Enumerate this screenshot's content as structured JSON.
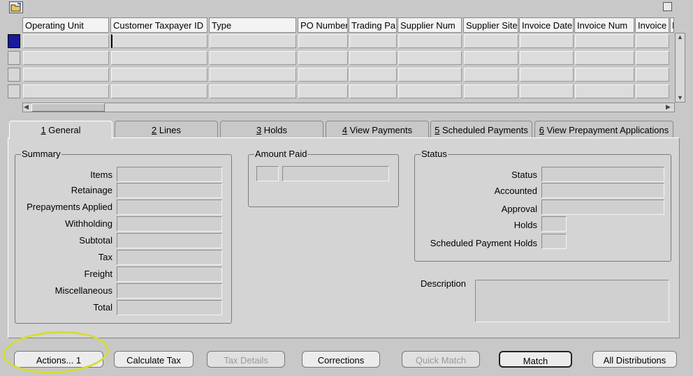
{
  "grid": {
    "columns": [
      "Operating Unit",
      "Customer Taxpayer ID",
      "Type",
      "PO Number",
      "Trading Pa",
      "Supplier Num",
      "Supplier Site",
      "Invoice Date",
      "Invoice Num",
      "Invoice",
      "I"
    ]
  },
  "tabs": [
    {
      "num": "1",
      "label": " General"
    },
    {
      "num": "2",
      "label": " Lines"
    },
    {
      "num": "3",
      "label": " Holds"
    },
    {
      "num": "4",
      "label": " View Payments"
    },
    {
      "num": "5",
      "label": " Scheduled Payments"
    },
    {
      "num": "6",
      "label": " View Prepayment Applications"
    }
  ],
  "summary": {
    "title": "Summary",
    "fields": [
      "Items",
      "Retainage",
      "Prepayments Applied",
      "Withholding",
      "Subtotal",
      "Tax",
      "Freight",
      "Miscellaneous",
      "Total"
    ]
  },
  "amount_paid": {
    "title": "Amount Paid"
  },
  "status_group": {
    "title": "Status",
    "fields": [
      "Status",
      "Accounted",
      "Approval",
      "Holds",
      "Scheduled Payment Holds"
    ]
  },
  "description": {
    "label": "Description"
  },
  "buttons": {
    "actions": "Actions... 1",
    "calculate_tax": "Calculate Tax",
    "tax_details": "Tax Details",
    "corrections": "Corrections",
    "quick_match": "Quick Match",
    "match": "Match",
    "all_distributions": "All Distributions"
  },
  "colors": {
    "background": "#c8c8c8",
    "panel": "#d4d4d4",
    "selected_row": "#1a1a9c",
    "highlight": "#d6dc34"
  }
}
